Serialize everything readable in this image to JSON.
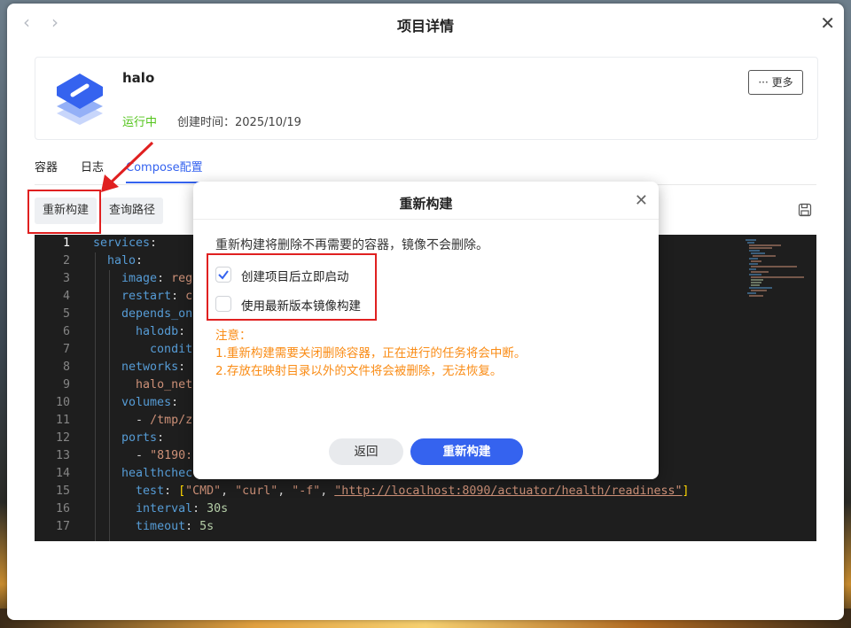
{
  "window": {
    "title": "项目详情",
    "back_icon": "‹",
    "forward_icon": "›",
    "close_icon": "✕"
  },
  "project": {
    "name": "halo",
    "status": "运行中",
    "created_label": "创建时间：2025/10/19",
    "more_label": "··· 更多",
    "status_color": "#52c41a"
  },
  "tabs": [
    {
      "label": "容器"
    },
    {
      "label": "日志"
    },
    {
      "label": "Compose配置"
    }
  ],
  "toolbar": {
    "rebuild_label": "重新构建",
    "query_path_label": "查询路径"
  },
  "editor": {
    "lines": [
      {
        "num": "1"
      },
      {
        "num": "2"
      },
      {
        "num": "3"
      },
      {
        "num": "4"
      },
      {
        "num": "5"
      },
      {
        "num": "6"
      },
      {
        "num": "7"
      },
      {
        "num": "8"
      },
      {
        "num": "9"
      },
      {
        "num": "10"
      },
      {
        "num": "11"
      },
      {
        "num": "12"
      },
      {
        "num": "13"
      },
      {
        "num": "14"
      },
      {
        "num": "15"
      },
      {
        "num": "16"
      },
      {
        "num": "17"
      }
    ],
    "t": {
      "services": "services",
      "colon": ":",
      "halo": "halo",
      "image": "image",
      "image_val": "reg",
      "restart": "restart",
      "restart_val": "c",
      "depends_on": "depends_on",
      "halodb": "halodb",
      "condit": "condit",
      "networks": "networks",
      "halo_net": "halo_net",
      "volumes": "volumes",
      "dash": "- ",
      "vol_val": "/tmp/z",
      "ports": "ports",
      "port_val": "\"8190:",
      "healthcheck": "healthchec",
      "test": "test",
      "bopen": "[",
      "bclose": "]",
      "comma": ", ",
      "cmd": "\"CMD\"",
      "curl": "\"curl\"",
      "f": "\"-f\"",
      "url": "\"http://localhost:8090/actuator/health/readiness\"",
      "interval": "interval",
      "interval_val": "30s",
      "timeout": "timeout",
      "timeout_val": "5s"
    }
  },
  "modal": {
    "title": "重新构建",
    "close_icon": "✕",
    "description": "重新构建将删除不再需要的容器，镜像不会删除。",
    "options": [
      {
        "label": "创建项目后立即启动",
        "checked": true
      },
      {
        "label": "使用最新版本镜像构建",
        "checked": false
      }
    ],
    "note_title": "注意：",
    "notes": [
      "1.重新构建需要关闭删除容器，正在进行的任务将会中断。",
      "2.存放在映射目录以外的文件将会被删除，无法恢复。"
    ],
    "back_label": "返回",
    "confirm_label": "重新构建"
  },
  "colors": {
    "accent": "#3563ef",
    "warning": "#fa8c16",
    "highlight_box": "#e02020"
  },
  "icons": [
    "back-icon",
    "forward-icon",
    "close-icon",
    "app-logo-icon",
    "save-icon",
    "checkmark-icon",
    "arrow-annotation-icon"
  ]
}
